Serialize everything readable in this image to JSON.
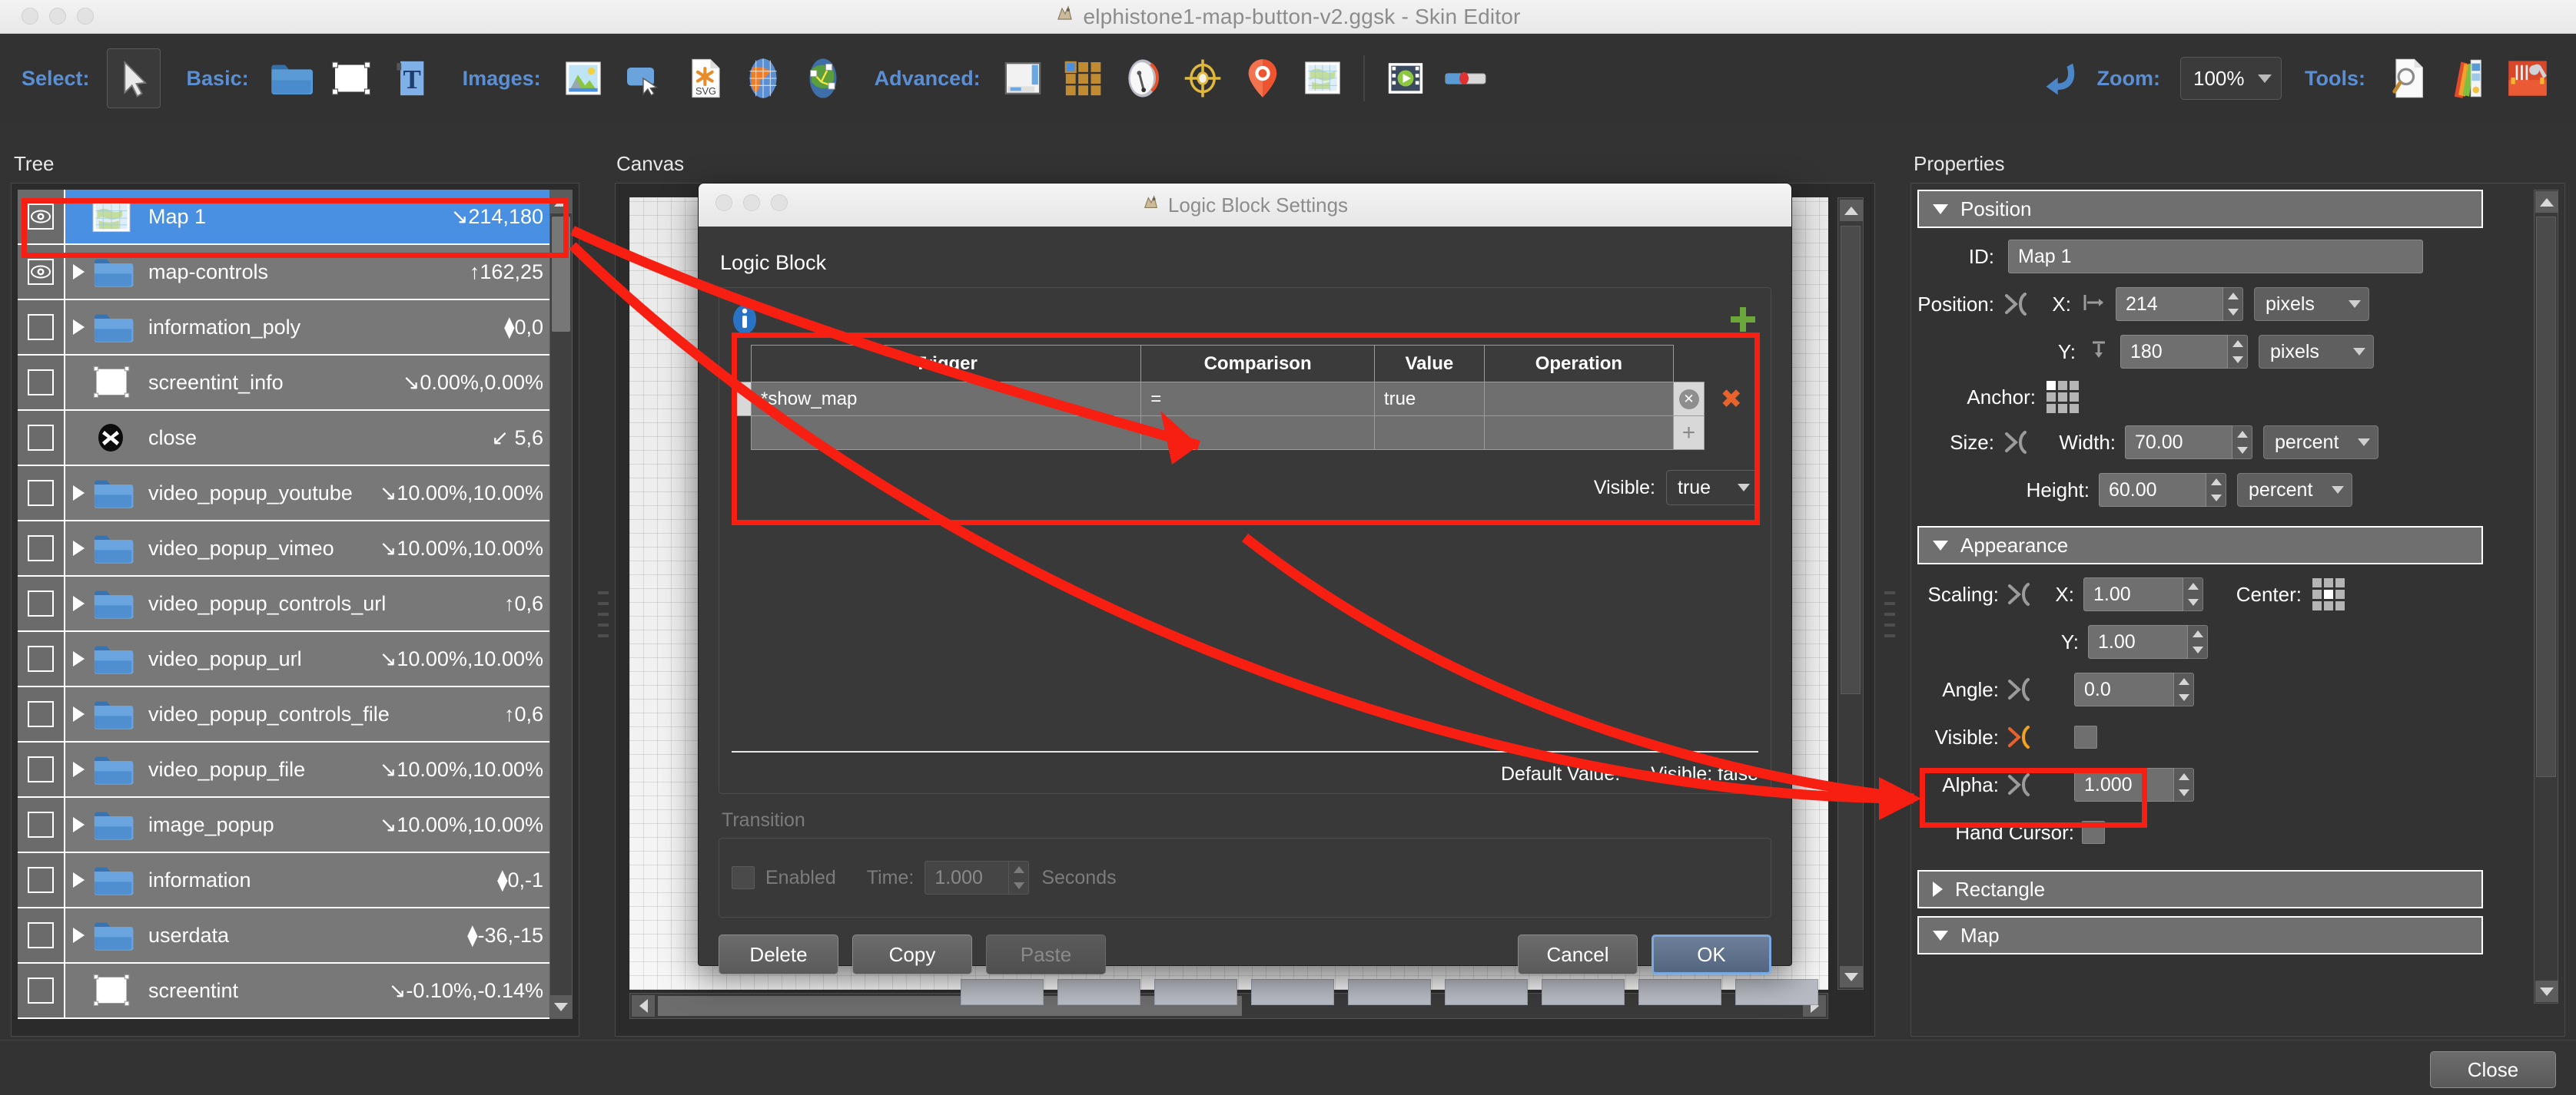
{
  "window": {
    "title": "elphistone1-map-button-v2.ggsk - Skin Editor",
    "app_icon": "griffin-icon"
  },
  "toolbar": {
    "groups": [
      {
        "label": "Select:",
        "items": [
          {
            "icon": "arrow-cursor-icon",
            "active": true
          }
        ]
      },
      {
        "label": "Basic:",
        "items": [
          {
            "icon": "folder-icon"
          },
          {
            "icon": "rectangle-icon"
          },
          {
            "icon": "text-icon"
          }
        ]
      },
      {
        "label": "Images:",
        "items": [
          {
            "icon": "image-icon"
          },
          {
            "icon": "button-icon"
          },
          {
            "icon": "svg-file-icon"
          },
          {
            "icon": "globe-orange-icon"
          },
          {
            "icon": "hotspot-globe-icon"
          }
        ]
      },
      {
        "label": "Advanced:",
        "items": [
          {
            "icon": "window-icon"
          },
          {
            "icon": "grid-tiles-icon"
          },
          {
            "icon": "compass-icon"
          },
          {
            "icon": "target-icon"
          },
          {
            "icon": "map-pin-icon"
          },
          {
            "icon": "world-map-icon"
          },
          {
            "icon": "video-icon"
          },
          {
            "icon": "slider-icon"
          }
        ]
      }
    ],
    "undo_icon": "undo-arrow-icon",
    "zoom_label": "Zoom:",
    "zoom_value": "100%",
    "tools_label": "Tools:",
    "tools_items": [
      {
        "icon": "magnifier-doc-icon"
      },
      {
        "icon": "color-palette-icon"
      },
      {
        "icon": "toolbox-icon"
      }
    ]
  },
  "tree": {
    "heading": "Tree",
    "rows": [
      {
        "eye": "on",
        "expandable": false,
        "icon": "map-thumb-icon",
        "label": "Map 1",
        "coord": "↘214,180",
        "selected": true
      },
      {
        "eye": "on",
        "expandable": true,
        "icon": "folder-icon",
        "label": "map-controls",
        "coord": "↑162,25",
        "selected": false
      },
      {
        "eye": "off",
        "expandable": true,
        "icon": "folder-icon",
        "label": "information_poly",
        "coord": "⧫0,0",
        "selected": false
      },
      {
        "eye": "off",
        "expandable": false,
        "icon": "white-rect-icon",
        "label": "screentint_info",
        "coord": "↘0.00%,0.00%",
        "selected": false
      },
      {
        "eye": "off",
        "expandable": false,
        "icon": "close-disc-icon",
        "label": "close",
        "coord": "↙ 5,6",
        "selected": false
      },
      {
        "eye": "off",
        "expandable": true,
        "icon": "folder-icon",
        "label": "video_popup_youtube",
        "coord": "↘10.00%,10.00%",
        "selected": false
      },
      {
        "eye": "off",
        "expandable": true,
        "icon": "folder-icon",
        "label": "video_popup_vimeo",
        "coord": "↘10.00%,10.00%",
        "selected": false
      },
      {
        "eye": "off",
        "expandable": true,
        "icon": "folder-icon",
        "label": "video_popup_controls_url",
        "coord": "↑0,6",
        "selected": false
      },
      {
        "eye": "off",
        "expandable": true,
        "icon": "folder-icon",
        "label": "video_popup_url",
        "coord": "↘10.00%,10.00%",
        "selected": false
      },
      {
        "eye": "off",
        "expandable": true,
        "icon": "folder-icon",
        "label": "video_popup_controls_file",
        "coord": "↑0,6",
        "selected": false
      },
      {
        "eye": "off",
        "expandable": true,
        "icon": "folder-icon",
        "label": "video_popup_file",
        "coord": "↘10.00%,10.00%",
        "selected": false
      },
      {
        "eye": "off",
        "expandable": true,
        "icon": "folder-icon",
        "label": "image_popup",
        "coord": "↘10.00%,10.00%",
        "selected": false
      },
      {
        "eye": "off",
        "expandable": true,
        "icon": "folder-icon",
        "label": "information",
        "coord": "⧫0,-1",
        "selected": false
      },
      {
        "eye": "off",
        "expandable": true,
        "icon": "folder-icon",
        "label": "userdata",
        "coord": "⧫-36,-15",
        "selected": false
      },
      {
        "eye": "off",
        "expandable": false,
        "icon": "white-rect-icon",
        "label": "screentint",
        "coord": "↘-0.10%,-0.14%",
        "selected": false
      }
    ]
  },
  "canvas": {
    "heading": "Canvas"
  },
  "properties": {
    "heading": "Properties",
    "sections": {
      "position": {
        "title": "Position",
        "expanded": true,
        "id_label": "ID:",
        "id_value": "Map 1",
        "position_label": "Position:",
        "x_label": "X:",
        "x_value": "214",
        "x_unit": "pixels",
        "y_label": "Y:",
        "y_value": "180",
        "y_unit": "pixels",
        "anchor_label": "Anchor:",
        "size_label": "Size:",
        "width_label": "Width:",
        "width_value": "70.00",
        "width_unit": "percent",
        "height_label": "Height:",
        "height_value": "60.00",
        "height_unit": "percent"
      },
      "appearance": {
        "title": "Appearance",
        "expanded": true,
        "scaling_label": "Scaling:",
        "scaling_x_label": "X:",
        "scaling_x_value": "1.00",
        "scaling_y_label": "Y:",
        "scaling_y_value": "1.00",
        "center_label": "Center:",
        "angle_label": "Angle:",
        "angle_value": "0.0",
        "visible_label": "Visible:",
        "visible_checked": false,
        "alpha_label": "Alpha:",
        "alpha_value": "1.000",
        "hand_cursor_label": "Hand Cursor:",
        "hand_cursor_checked": false
      },
      "rectangle": {
        "title": "Rectangle",
        "expanded": false
      },
      "map": {
        "title": "Map",
        "expanded": true
      }
    }
  },
  "dialog": {
    "title": "Logic Block Settings",
    "app_icon": "griffin-icon",
    "heading": "Logic Block",
    "info_icon": "info-icon",
    "add_icon": "plus-green-icon",
    "table": {
      "columns": [
        "Trigger",
        "Comparison",
        "Value",
        "Operation"
      ],
      "rows": [
        {
          "trigger": "*show_map",
          "comparison": "=",
          "value": "true",
          "operation": ""
        },
        {
          "trigger": "",
          "comparison": "",
          "value": "",
          "operation": ""
        }
      ]
    },
    "visible_label": "Visible:",
    "visible_value": "true",
    "default_value_label": "Default Value:",
    "default_value_text": "Visible:  false",
    "transition": {
      "title": "Transition",
      "enabled_label": "Enabled",
      "enabled_checked": false,
      "time_label": "Time:",
      "time_value": "1.000",
      "seconds_label": "Seconds"
    },
    "buttons": {
      "delete": "Delete",
      "copy": "Copy",
      "paste": "Paste",
      "cancel": "Cancel",
      "ok": "OK"
    }
  },
  "bottom": {
    "close_label": "Close"
  },
  "colors": {
    "accent_blue": "#5b8fd4",
    "selection_blue": "#4a90e2",
    "annotation_red": "#f71f12",
    "panel_dark": "#333333",
    "row_gray": "#787878"
  }
}
